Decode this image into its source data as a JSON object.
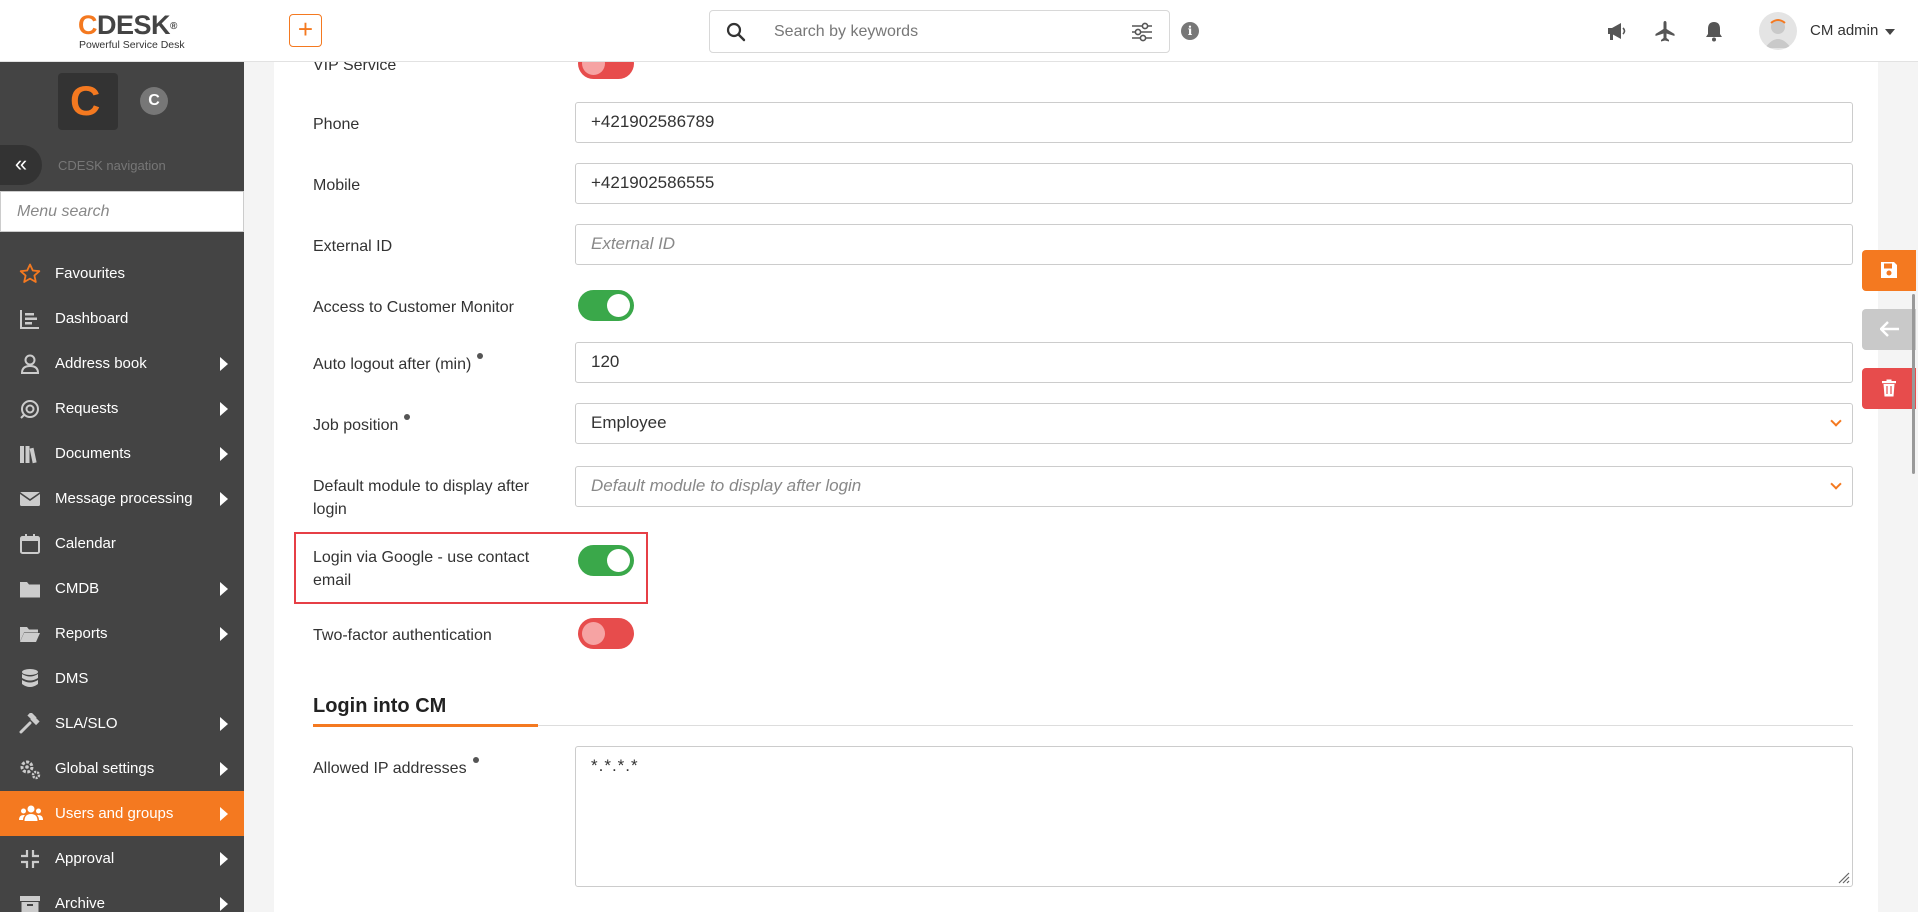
{
  "header": {
    "logo_mark": "C",
    "logo_text": "DESK",
    "logo_reg": "®",
    "logo_tagline": "Powerful Service Desk",
    "add_label": "+",
    "search_placeholder": "Search by keywords",
    "info_label": "i",
    "user_name": "CM admin"
  },
  "sidebar": {
    "logo_mark": "C",
    "secondary_mark": "C",
    "toggle_label": "«",
    "nav_label": "CDESK navigation",
    "search_placeholder": "Menu search",
    "items": [
      {
        "label": "Favourites",
        "icon": "star-icon",
        "arrow": false
      },
      {
        "label": "Dashboard",
        "icon": "chart-icon",
        "arrow": false
      },
      {
        "label": "Address book",
        "icon": "user-icon",
        "arrow": true
      },
      {
        "label": "Requests",
        "icon": "requests-icon",
        "arrow": true
      },
      {
        "label": "Documents",
        "icon": "books-icon",
        "arrow": true
      },
      {
        "label": "Message processing",
        "icon": "envelope-icon",
        "arrow": true
      },
      {
        "label": "Calendar",
        "icon": "calendar-icon",
        "arrow": false
      },
      {
        "label": "CMDB",
        "icon": "folder-icon",
        "arrow": true
      },
      {
        "label": "Reports",
        "icon": "folder-open-icon",
        "arrow": true
      },
      {
        "label": "DMS",
        "icon": "database-icon",
        "arrow": false
      },
      {
        "label": "SLA/SLO",
        "icon": "gavel-icon",
        "arrow": true
      },
      {
        "label": "Global settings",
        "icon": "gears-icon",
        "arrow": true
      },
      {
        "label": "Users and groups",
        "icon": "users-icon",
        "arrow": true,
        "active": true
      },
      {
        "label": "Approval",
        "icon": "compress-icon",
        "arrow": true
      },
      {
        "label": "Archive",
        "icon": "archive-icon",
        "arrow": true
      }
    ]
  },
  "form": {
    "vip_service": {
      "label": "VIP Service",
      "value": "off"
    },
    "phone": {
      "label": "Phone",
      "value": "+421902586789"
    },
    "mobile": {
      "label": "Mobile",
      "value": "+421902586555"
    },
    "external_id": {
      "label": "External ID",
      "placeholder": "External ID"
    },
    "customer_monitor": {
      "label": "Access to Customer Monitor",
      "value": "on"
    },
    "auto_logout": {
      "label": "Auto logout after (min)",
      "value": "120"
    },
    "job_position": {
      "label": "Job position",
      "value": "Employee"
    },
    "default_module": {
      "label_line1": "Default module to display after",
      "label_line2": "login",
      "placeholder": "Default module to display after login"
    },
    "google_login": {
      "label_line1": "Login via Google - use contact",
      "label_line2": "email",
      "value": "on"
    },
    "two_factor": {
      "label": "Two-factor authentication",
      "value": "off"
    }
  },
  "login_section": {
    "title": "Login into CM",
    "allowed_ip": {
      "label": "Allowed IP addresses",
      "value": "*.*.*.*"
    }
  },
  "colors": {
    "accent": "#f47920",
    "toggle_on": "#3aa84a",
    "toggle_off": "#e74c4c",
    "sidebar_bg": "#444444",
    "highlight": "#e63f46"
  }
}
